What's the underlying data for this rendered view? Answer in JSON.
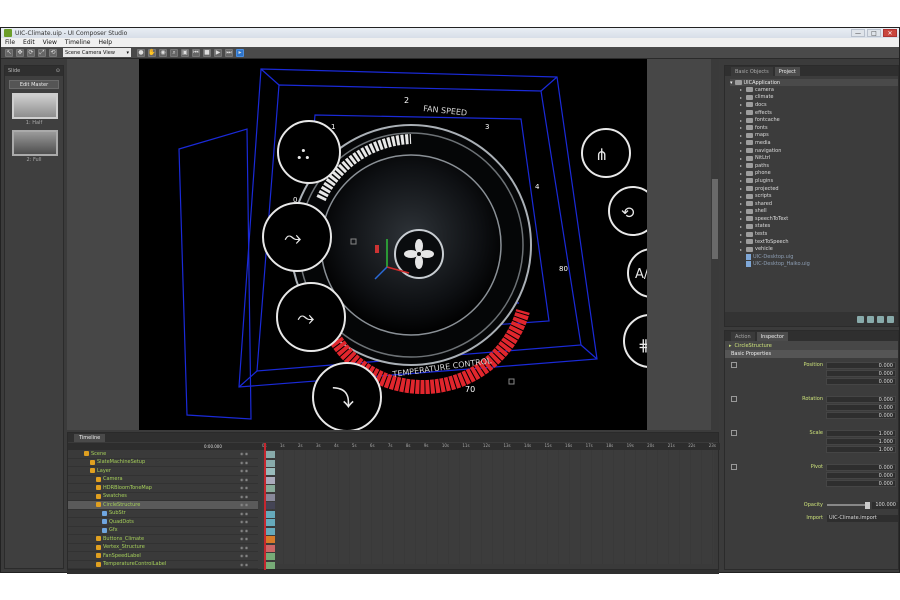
{
  "window": {
    "title": "UIC-Climate.uip - UI Composer Studio",
    "buttons": {
      "minimize": "—",
      "maximize": "□",
      "close": "✕"
    }
  },
  "menu": [
    "File",
    "Edit",
    "View",
    "Timeline",
    "Help"
  ],
  "toolbar": {
    "camera_view": "Scene Camera View"
  },
  "slides_panel": {
    "tab": "Slide",
    "edit_master": "Edit Master",
    "slides": [
      {
        "label": "1: Half"
      },
      {
        "label": "2: Full"
      }
    ]
  },
  "viewport": {
    "fan_speed_label": "FAN SPEED",
    "temperature_label": "TEMPERATURE CONTROL",
    "scale_values": {
      "fan_1": "1",
      "fan_2": "2",
      "fan_3": "3",
      "fan_4": "4",
      "fan_0": "0",
      "temp_60": "60",
      "temp_70": "70",
      "temp_80": "80"
    },
    "ac_label": "A/C"
  },
  "project_panel": {
    "tabs": [
      "Basic Objects",
      "Project"
    ],
    "root": "UICApplication",
    "folders": [
      "camera",
      "climate",
      "docs",
      "effects",
      "fontcache",
      "fonts",
      "maps",
      "media",
      "navigation",
      "NitLtrl",
      "paths",
      "phone",
      "plugins",
      "projected",
      "scripts",
      "shared",
      "shell",
      "speechToText",
      "states",
      "tests",
      "textToSpeech",
      "vehicle"
    ],
    "files": [
      "UIC-Desktop.uig",
      "UIC-Desktop_Haiko.uig"
    ]
  },
  "inspector": {
    "tabs": [
      "Action",
      "Inspector"
    ],
    "object": "CircleStructure",
    "section": "Basic Properties",
    "groups": [
      {
        "label": "Position",
        "values": [
          "0.000",
          "0.000",
          "0.000"
        ]
      },
      {
        "label": "Rotation",
        "values": [
          "0.000",
          "0.000",
          "0.000"
        ]
      },
      {
        "label": "Scale",
        "values": [
          "1.000",
          "1.000",
          "1.000"
        ]
      },
      {
        "label": "Pivot",
        "values": [
          "0.000",
          "0.000",
          "0.000"
        ]
      }
    ],
    "opacity_label": "Opacity",
    "opacity_value": "100.000",
    "import_label": "Import",
    "import_value": "UIC-Climate.import"
  },
  "timeline": {
    "tab": "Timeline",
    "time": "0:00.000",
    "ruler": [
      "0s",
      "1s",
      "2s",
      "3s",
      "4s",
      "5s",
      "6s",
      "7s",
      "8s",
      "9s",
      "10s",
      "11s",
      "12s",
      "13s",
      "14s",
      "15s",
      "16s",
      "17s",
      "18s",
      "19s",
      "20s",
      "21s",
      "22s",
      "23s"
    ],
    "rows": [
      {
        "name": "Scene",
        "depth": 0
      },
      {
        "name": "SlateMachineSetup",
        "depth": 1
      },
      {
        "name": "Layer",
        "depth": 1
      },
      {
        "name": "Camera",
        "depth": 2
      },
      {
        "name": "HDRBloomToneMap",
        "depth": 2
      },
      {
        "name": "Swatches",
        "depth": 2
      },
      {
        "name": "CircleStructure",
        "depth": 2
      },
      {
        "name": "SubStr",
        "depth": 3
      },
      {
        "name": "QuadDots",
        "depth": 3
      },
      {
        "name": "Gfx",
        "depth": 3
      },
      {
        "name": "Buttons_Climate",
        "depth": 2
      },
      {
        "name": "Vertex_Structure",
        "depth": 2
      },
      {
        "name": "FanSpeedLabel",
        "depth": 2
      },
      {
        "name": "TemperatureControlLabel",
        "depth": 2
      }
    ]
  }
}
